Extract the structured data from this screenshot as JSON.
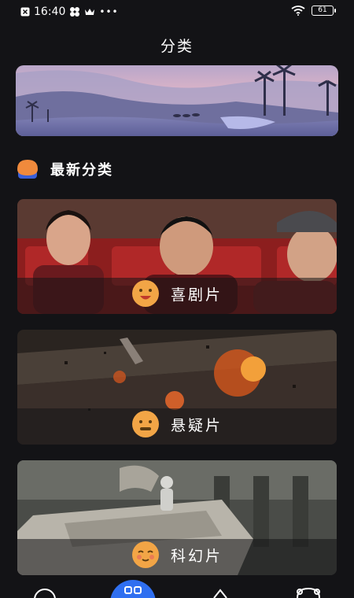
{
  "status_bar": {
    "time": "16:40",
    "battery": "61",
    "icons": [
      "close-box-icon",
      "flower-icon",
      "crown-icon",
      "more-dots-icon",
      "wifi-icon",
      "battery-icon"
    ]
  },
  "header": {
    "title": "分类"
  },
  "section": {
    "title": "最新分类"
  },
  "categories": [
    {
      "label": "喜剧片",
      "emoji": "smile-face-icon"
    },
    {
      "label": "悬疑片",
      "emoji": "worried-face-icon"
    },
    {
      "label": "科幻片",
      "emoji": "shy-face-icon"
    }
  ],
  "bottom_nav": {
    "items": [
      "home-icon",
      "category-icon",
      "upload-icon",
      "profile-icon"
    ],
    "active": "category-icon"
  },
  "colors": {
    "background": "#131316",
    "emoji_orange": "#f2a546",
    "active_nav": "#2f6ff0"
  }
}
